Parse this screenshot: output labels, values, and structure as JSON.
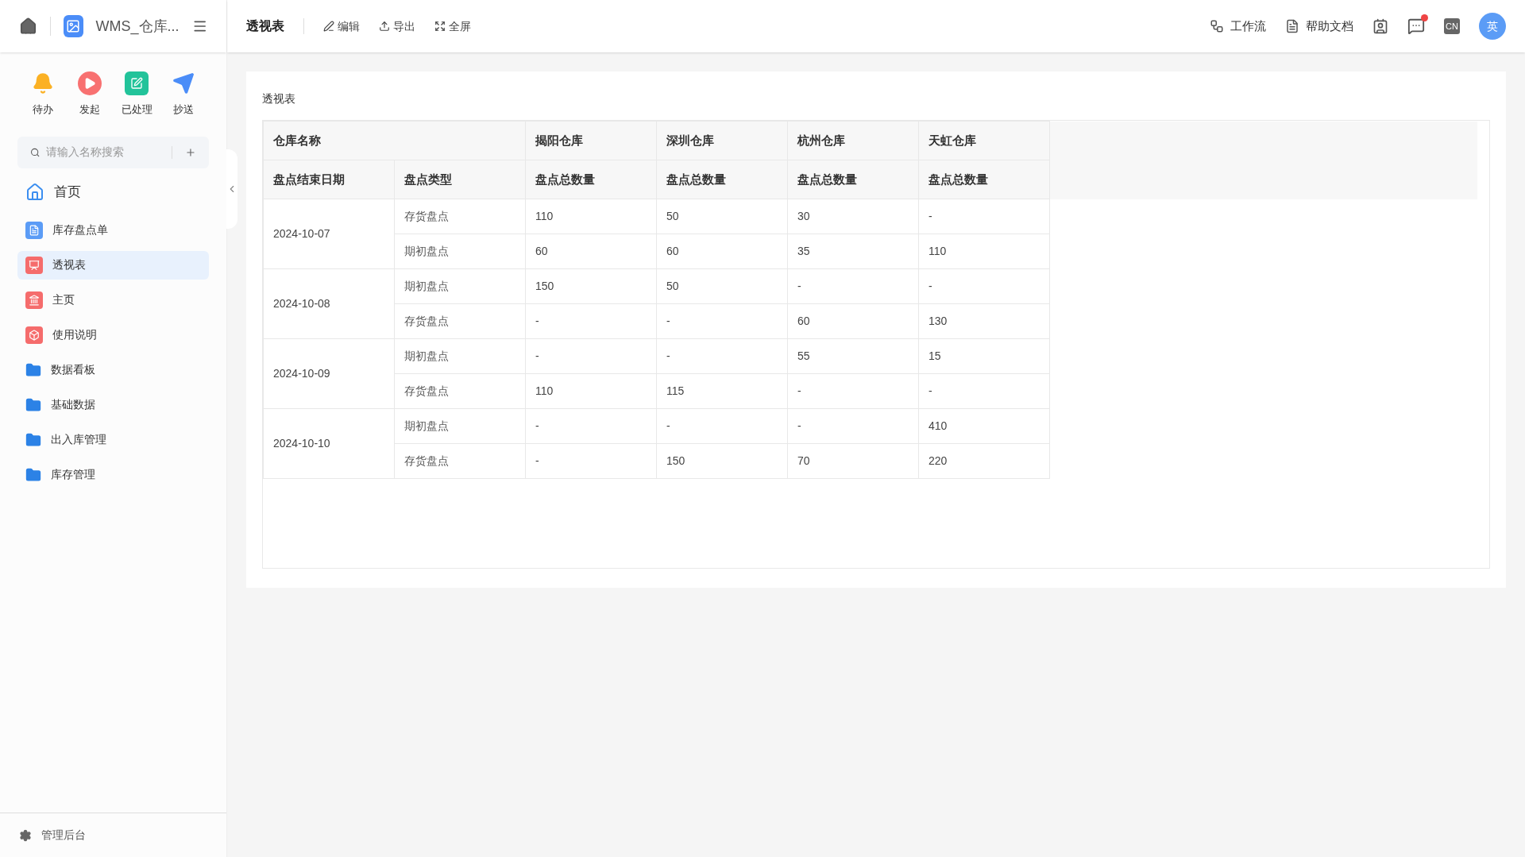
{
  "app": {
    "title": "WMS_仓库..."
  },
  "quick_actions": [
    {
      "kind": "bell",
      "label": "待办"
    },
    {
      "kind": "play",
      "label": "发起"
    },
    {
      "kind": "done",
      "label": "已处理"
    },
    {
      "kind": "send",
      "label": "抄送"
    }
  ],
  "search": {
    "placeholder": "请输入名称搜索"
  },
  "nav": [
    {
      "kind": "home",
      "label": "首页",
      "selected": false
    },
    {
      "kind": "doc",
      "label": "库存盘点单",
      "selected": false
    },
    {
      "kind": "chart",
      "label": "透视表",
      "selected": true
    },
    {
      "kind": "bank",
      "label": "主页",
      "selected": false
    },
    {
      "kind": "box",
      "label": "使用说明",
      "selected": false
    },
    {
      "kind": "folder",
      "label": "数据看板",
      "selected": false
    },
    {
      "kind": "folder",
      "label": "基础数据",
      "selected": false
    },
    {
      "kind": "folder",
      "label": "出入库管理",
      "selected": false
    },
    {
      "kind": "folder",
      "label": "库存管理",
      "selected": false
    }
  ],
  "admin": {
    "label": "管理后台"
  },
  "toolbar": {
    "title": "透视表",
    "actions": [
      {
        "kind": "edit",
        "label": "编辑"
      },
      {
        "kind": "export",
        "label": "导出"
      },
      {
        "kind": "fullscreen",
        "label": "全屏"
      }
    ]
  },
  "top_right": {
    "links": [
      {
        "kind": "workflow",
        "label": "工作流"
      },
      {
        "kind": "help",
        "label": "帮助文档"
      }
    ],
    "messages_unread": true,
    "language": "CN",
    "avatar": "英"
  },
  "panel": {
    "title": "透视表"
  },
  "table": {
    "corner": "仓库名称",
    "warehouses": [
      "揭阳仓库",
      "深圳仓库",
      "杭州仓库",
      "天虹仓库"
    ],
    "row_headers": [
      "盘点结束日期",
      "盘点类型"
    ],
    "measures": [
      "盘点总数量",
      "盘点总数量",
      "盘点总数量",
      "盘点总数量"
    ],
    "groups": [
      {
        "date": "2024-10-07",
        "rows": [
          {
            "type": "存货盘点",
            "values": [
              "110",
              "50",
              "30",
              "-"
            ]
          },
          {
            "type": "期初盘点",
            "values": [
              "60",
              "60",
              "35",
              "110"
            ]
          }
        ]
      },
      {
        "date": "2024-10-08",
        "rows": [
          {
            "type": "期初盘点",
            "values": [
              "150",
              "50",
              "-",
              "-"
            ]
          },
          {
            "type": "存货盘点",
            "values": [
              "-",
              "-",
              "60",
              "130"
            ]
          }
        ]
      },
      {
        "date": "2024-10-09",
        "rows": [
          {
            "type": "期初盘点",
            "values": [
              "-",
              "-",
              "55",
              "15"
            ]
          },
          {
            "type": "存货盘点",
            "values": [
              "110",
              "115",
              "-",
              "-"
            ]
          }
        ]
      },
      {
        "date": "2024-10-10",
        "rows": [
          {
            "type": "期初盘点",
            "values": [
              "-",
              "-",
              "-",
              "410"
            ]
          },
          {
            "type": "存货盘点",
            "values": [
              "-",
              "150",
              "70",
              "220"
            ]
          }
        ]
      }
    ]
  }
}
